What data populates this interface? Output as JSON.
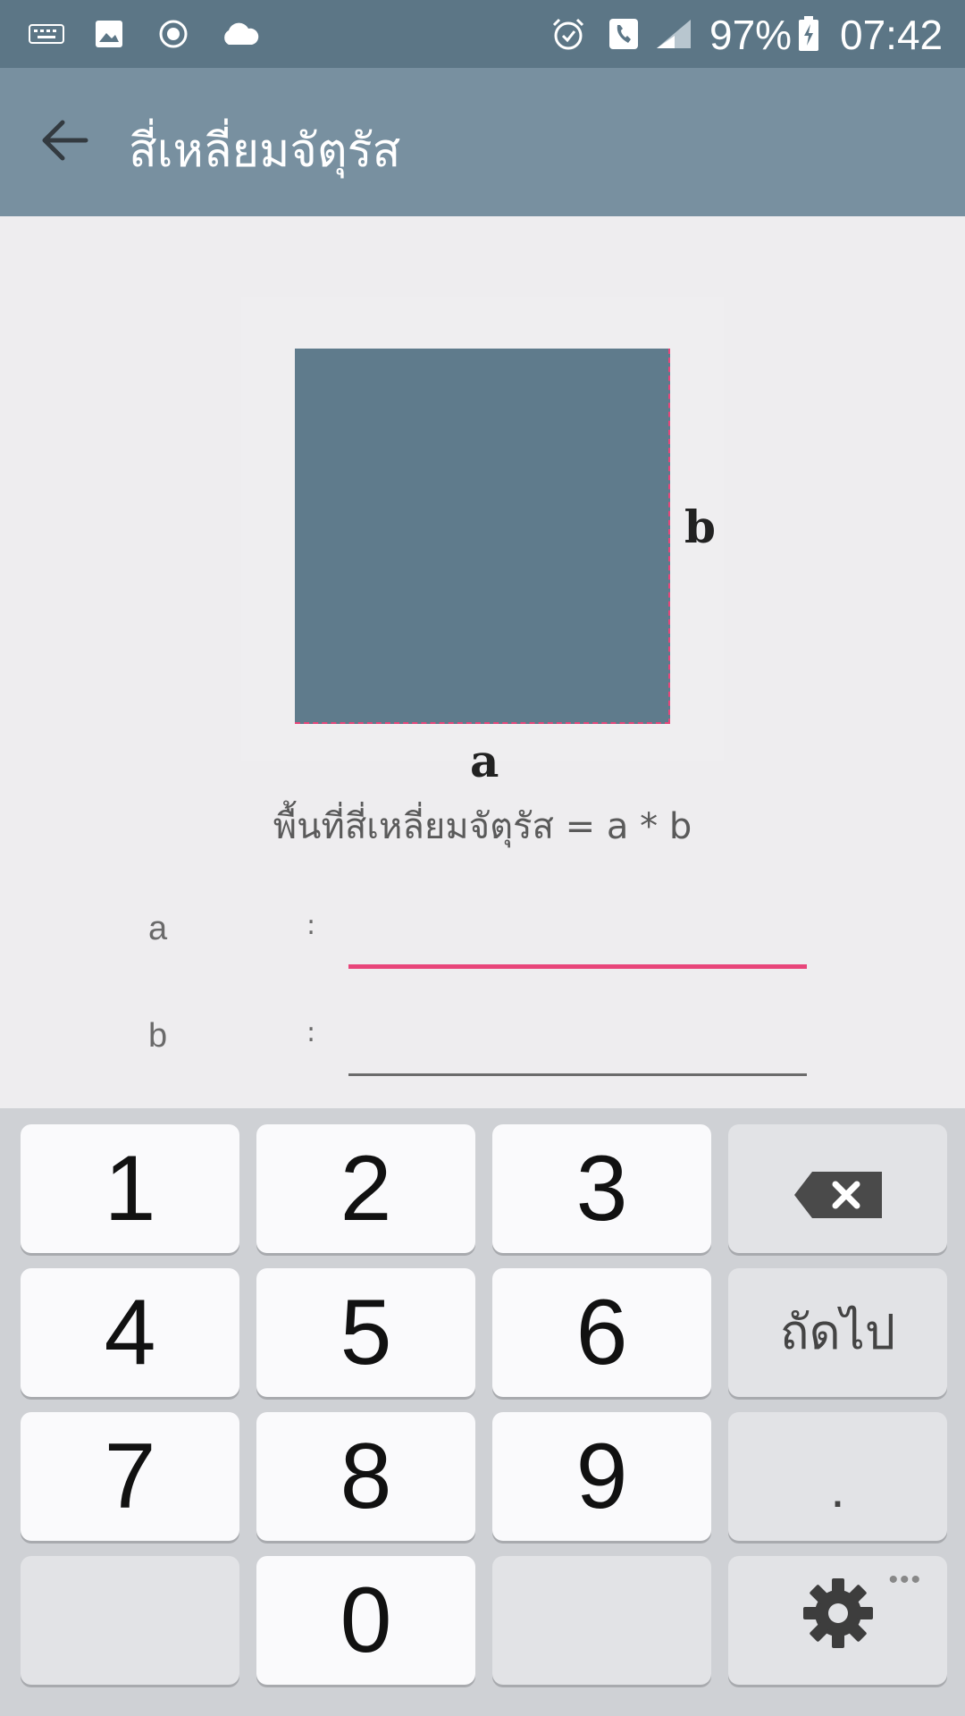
{
  "status_bar": {
    "battery": "97%",
    "time": "07:42",
    "icons": [
      "keyboard-icon",
      "image-icon",
      "record-icon",
      "cloud-icon",
      "alarm-icon",
      "phone-icon",
      "signal-icon",
      "battery-charging-icon"
    ]
  },
  "app_bar": {
    "title": "สี่เหลี่ยมจัตุรัส",
    "back_icon": "back-arrow-icon"
  },
  "figure": {
    "label_a": "a",
    "label_b": "b",
    "square_color": "#5f7b8c",
    "edge_color": "#e8457a"
  },
  "formula": "พื้นที่สี่เหลี่ยมจัตุรัส = a * b",
  "fields": [
    {
      "label": "a",
      "colon": ":",
      "value": "",
      "placeholder": ""
    },
    {
      "label": "b",
      "colon": ":",
      "value": "",
      "placeholder": ""
    }
  ],
  "keyboard": {
    "keys": [
      "1",
      "2",
      "3",
      "4",
      "5",
      "6",
      "7",
      "8",
      "9",
      "0"
    ],
    "next_label": "ถัดไป",
    "dot_label": ".",
    "ellipsis": "•••",
    "delete_icon": "backspace-icon",
    "settings_icon": "gear-icon"
  },
  "colors": {
    "status_bar": "#5c7686",
    "app_bar": "#7890a0",
    "accent": "#e8457a"
  }
}
